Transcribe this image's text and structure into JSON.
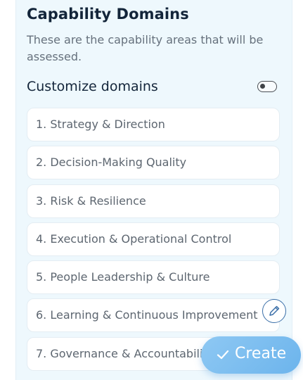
{
  "header": {
    "title": "Capability Domains",
    "subtitle": "These are the capability areas that will be assessed."
  },
  "customize": {
    "label": "Customize domains",
    "toggle_on": false
  },
  "domains": [
    "1. Strategy & Direction",
    "2. Decision-Making Quality",
    "3. Risk & Resilience",
    "4. Execution & Operational Control",
    "5. People Leadership & Culture",
    "6. Learning & Continuous Improvement",
    "7. Governance & Accountability"
  ],
  "actions": {
    "create_label": "Create",
    "edit_icon": "pencil-icon",
    "create_icon": "check-icon"
  },
  "colors": {
    "panel_bg": "#eef8fd",
    "accent": "#7abcf0",
    "heading": "#13253a"
  }
}
